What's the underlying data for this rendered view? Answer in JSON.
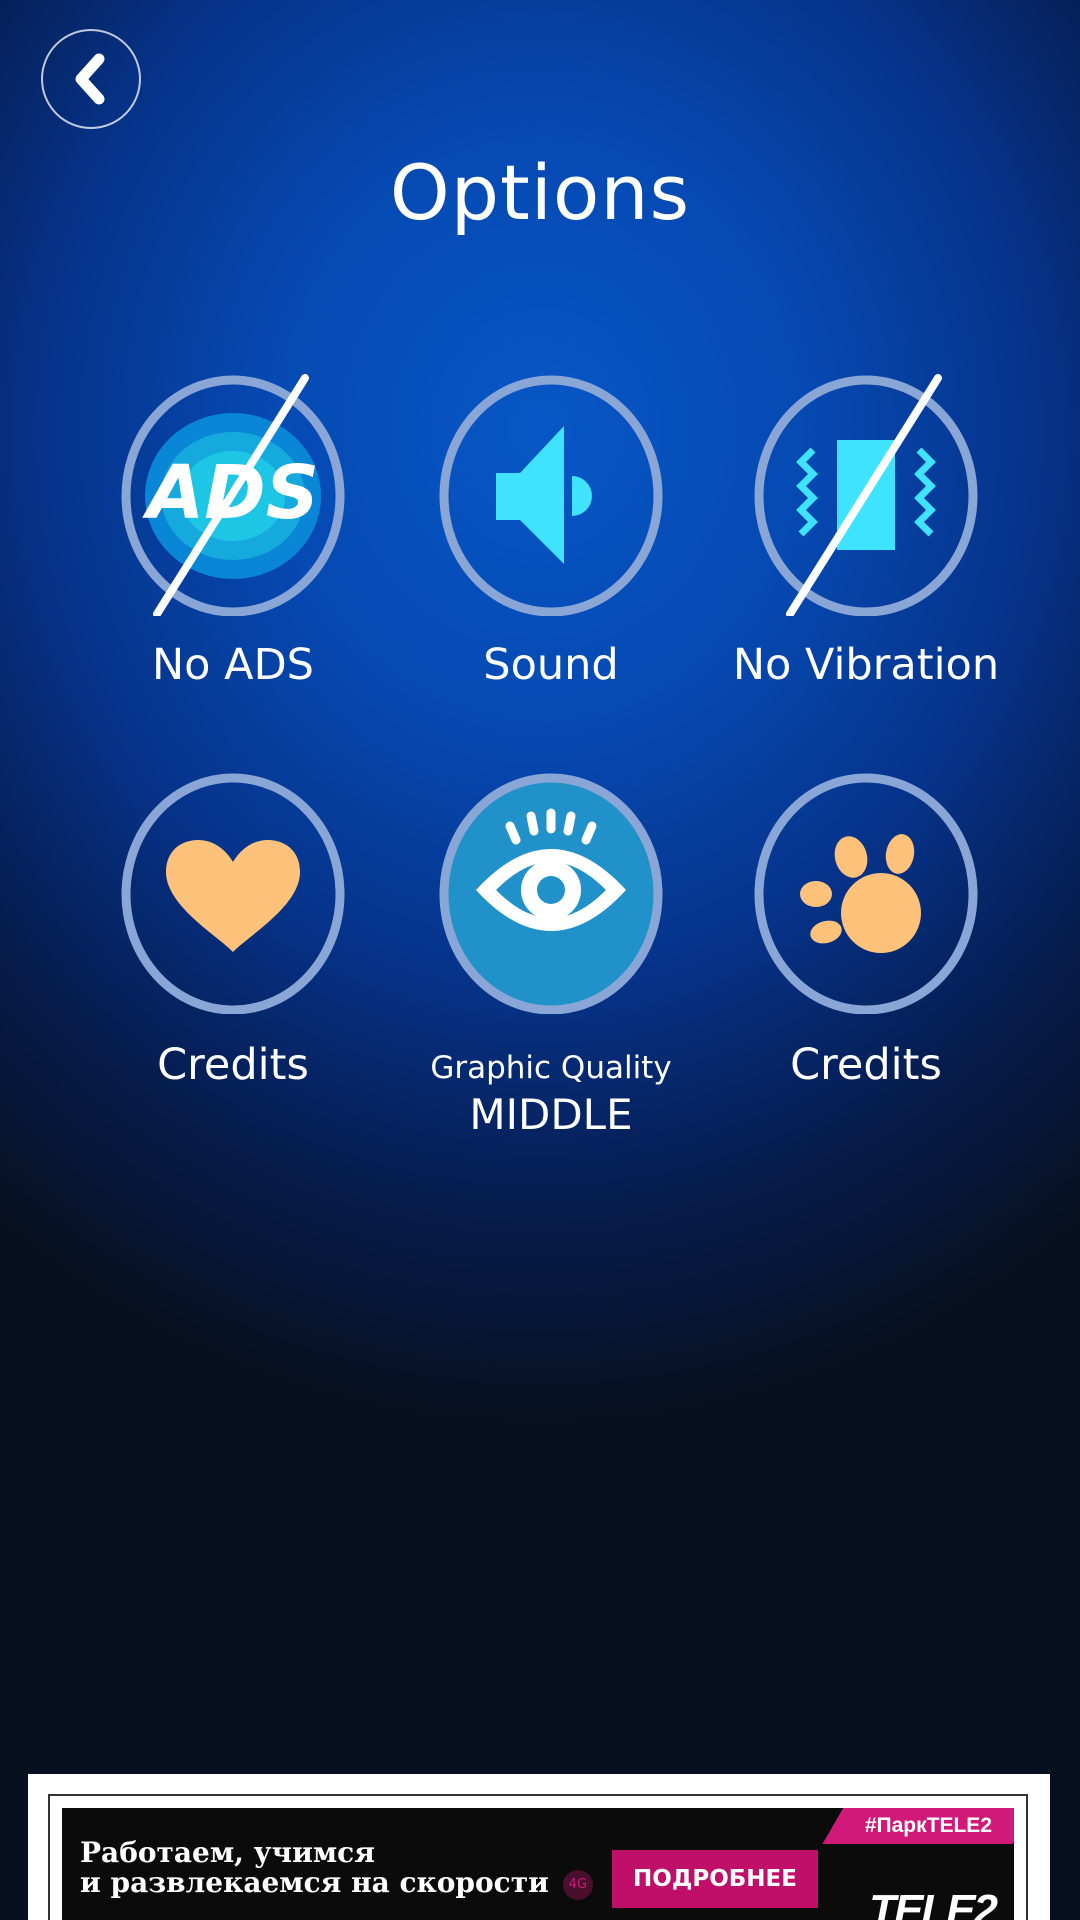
{
  "header": {
    "title": "Options",
    "back_icon": "chevron-left-icon"
  },
  "options": [
    {
      "label": "No ADS",
      "icon": "no-ads-icon",
      "state": "off"
    },
    {
      "label": "Sound",
      "icon": "speaker-icon",
      "state": "on"
    },
    {
      "label": "No Vibration",
      "icon": "vibration-icon",
      "state": "off"
    },
    {
      "label": "Credits",
      "icon": "heart-icon"
    },
    {
      "label": "Graphic Quality",
      "value": "MIDDLE",
      "icon": "eye-icon",
      "state": "selected"
    },
    {
      "label": "Credits",
      "icon": "paw-icon"
    }
  ],
  "ad": {
    "line1": "Работаем, учимся",
    "line2": "и развлекаемся на скорости",
    "badge": "4G",
    "button": "ПОДРОБНЕЕ",
    "hashtag": "#ПаркTELE2",
    "logo": "TELE2"
  },
  "colors": {
    "background_center": "#0757c6",
    "background_edge": "#07101e",
    "ring": "#8aa6d6",
    "cyan": "#3fe3ff",
    "peach": "#ffc27a",
    "selected_fill": "#2191c9",
    "ad_accent": "#d1197a"
  }
}
